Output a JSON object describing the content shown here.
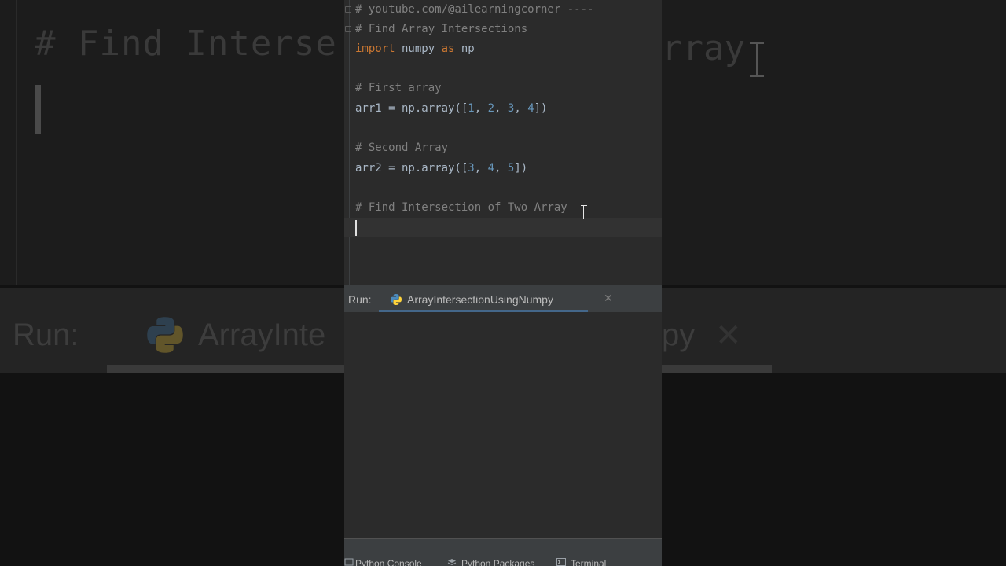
{
  "editor": {
    "lines": [
      {
        "comment": "# youtube.com/@ailearningcorner ----"
      },
      {
        "comment": "# Find Array Intersections"
      },
      {
        "kw_import": "import",
        "module": " numpy ",
        "kw_as": "as",
        "alias": " np"
      },
      {
        "blank": ""
      },
      {
        "comment": "# First array"
      },
      {
        "var": "arr1 = np.array([",
        "n1": "1",
        "s1": ", ",
        "n2": "2",
        "s2": ", ",
        "n3": "3",
        "s3": ", ",
        "n4": "4",
        "end": "])"
      },
      {
        "blank": ""
      },
      {
        "comment": "# Second Array"
      },
      {
        "var": "arr2 = np.array([",
        "n1": "3",
        "s1": ", ",
        "n2": "4",
        "s2": ", ",
        "n3": "5",
        "end": "])"
      },
      {
        "blank": ""
      },
      {
        "comment": "# Find Intersection of Two Array"
      }
    ]
  },
  "background": {
    "code_left": "# Find Interse",
    "code_right": "rray",
    "run_label": "Run:",
    "run_tab_left": "ArrayInte",
    "run_tab_right": "py"
  },
  "run_panel": {
    "label": "Run:",
    "tab_title": "ArrayIntersectionUsingNumpy",
    "close_glyph": "✕"
  },
  "bottom_bar": {
    "python_console": "Python Console",
    "python_packages": "Python Packages",
    "terminal": "Terminal"
  },
  "colors": {
    "comment": "#808080",
    "keyword": "#cc7832",
    "number": "#6897bb",
    "text": "#a9b7c6",
    "accent": "#4a88c7"
  }
}
